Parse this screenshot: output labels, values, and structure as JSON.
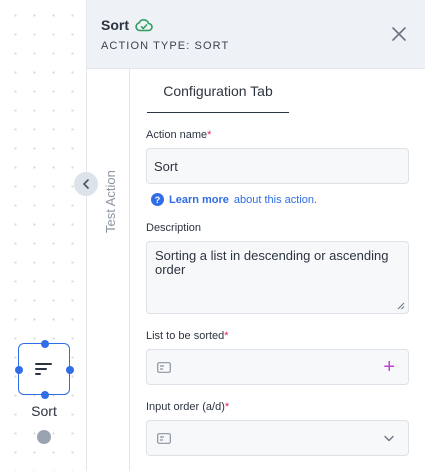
{
  "canvas": {
    "node": {
      "label": "Sort",
      "icon": "sort-lines-icon"
    }
  },
  "panel": {
    "title": "Sort",
    "status_icon": "cloud-check-icon",
    "action_type": "ACTION TYPE: SORT",
    "close_icon": "close-icon",
    "side_tab": "Test Action",
    "tab_label": "Configuration Tab",
    "fields": {
      "action_name": {
        "label": "Action name",
        "required": "*",
        "value": "Sort"
      },
      "learn": {
        "link": "Learn more",
        "rest": " about this action."
      },
      "description": {
        "label": "Description",
        "value": "Sorting a list in descending or ascending order"
      },
      "list_to_sort": {
        "label": "List to be sorted",
        "required": "*",
        "add_icon": "+"
      },
      "input_order": {
        "label": "Input order (a/d)",
        "required": "*"
      }
    }
  },
  "colors": {
    "accent": "#2f6ee6",
    "required": "#e2245f",
    "add": "#c03fd0",
    "cloud": "#2e9e5b"
  }
}
